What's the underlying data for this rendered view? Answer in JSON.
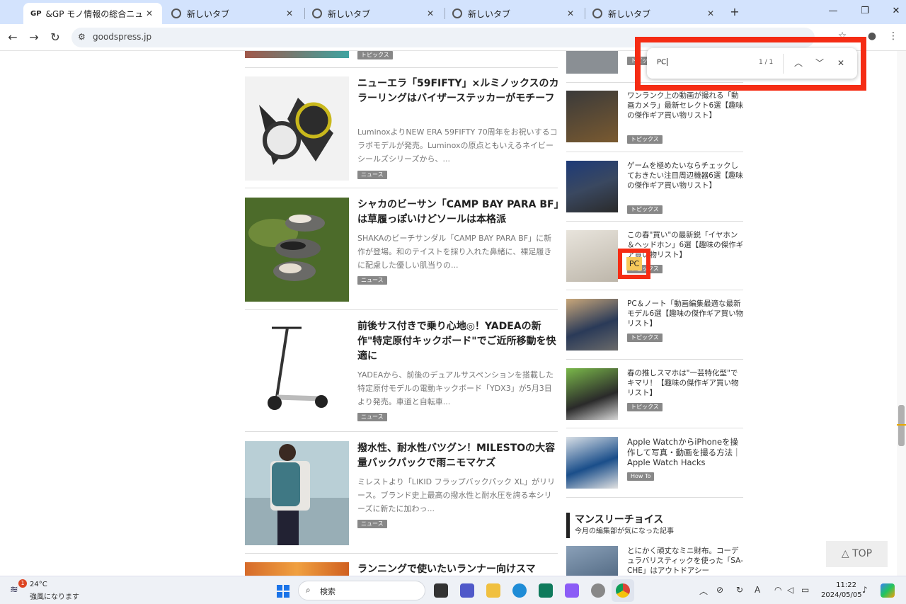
{
  "browser": {
    "tabs": [
      {
        "label": "&GP モノ情報の総合ニュースサイト",
        "favicon": "GP"
      },
      {
        "label": "新しいタブ"
      },
      {
        "label": "新しいタブ"
      },
      {
        "label": "新しいタブ"
      },
      {
        "label": "新しいタブ"
      }
    ],
    "url": "goodspress.jp"
  },
  "find_bar": {
    "query": "PC",
    "count": "1 / 1",
    "highlight_color": "#f52c14"
  },
  "articles": [
    {
      "title": "ニューエラ「59FIFTY」×ルミノックスのカラーリングはバイザーステッカーがモチーフ",
      "excerpt": "LuminoxよりNEW ERA 59FIFTY 70周年をお祝いするコラボモデルが発売。Luminoxの原点ともいえるネイビーシールズシリーズから、...",
      "tag": "ニュース"
    },
    {
      "title": "シャカのビーサン「CAMP BAY PARA BF」は草履っぽいけどソールは本格派",
      "excerpt": "SHAKAのビーチサンダル「CAMP BAY PARA BF」に新作が登場。和のテイストを採り入れた鼻緒に、裸足履きに配慮した優しい肌当りの...",
      "tag": "ニュース"
    },
    {
      "title": "前後サス付きで乗り心地◎！YADEAの新作\"特定原付キックボード\"でご近所移動を快適に",
      "excerpt": "YADEAから、前後のデュアルサスペンションを搭載した特定原付モデルの電動キックボード「YDX3」が5月3日より発売。車道と自転車...",
      "tag": "ニュース"
    },
    {
      "title": "撥水性、耐水性バツグン！MILESTOの大容量バックパックで雨ニモマケズ",
      "excerpt": "ミレストより「LIKID フラップバックパック XL」がリリース。ブランド史上最高の撥水性と耐水圧を誇る本シリーズに新たに加わっ...",
      "tag": "ニュース"
    },
    {
      "title": "ランニングで使いたいランナー向けスマ"
    }
  ],
  "top_partial_tag": "トピックス",
  "sidebar": {
    "items": [
      {
        "title": "",
        "tag": "トピックス"
      },
      {
        "title": "ワンランク上の動画が撮れる「動画カメラ」最新セレクト6選【趣味の傑作ギア買い物リスト】",
        "tag": "トピックス"
      },
      {
        "title": "ゲームを極めたいならチェックしておきたい注目周辺機器6選【趣味の傑作ギア買い物リスト】",
        "tag": "トピックス"
      },
      {
        "title": "この春\"買い\"の最新鋭「イヤホン＆ヘッドホン」6選【趣味の傑作ギア買い物リスト】",
        "tag": "トピックス"
      },
      {
        "title": "PC＆ノート「動画編集最適な最新モデル6選【趣味の傑作ギア買い物リスト】",
        "tag": "トピックス"
      },
      {
        "title": "春の推しスマホは\"一芸特化型\"でキマリ！【趣味の傑作ギア買い物リスト】",
        "tag": "トピックス"
      },
      {
        "title": "Apple WatchからiPhoneを操作して写真・動画を撮る方法｜Apple Watch Hacks",
        "tag": "How To"
      }
    ],
    "highlight_word": "PC",
    "section": {
      "title": "マンスリーチョイス",
      "subtitle": "今月の編集部が気になった記事"
    },
    "monthly_item": "とにかく頑丈なミニ財布。コーデュラバリスティックを使った「SA-CHE」はアウトドアシー"
  },
  "top_button": "△ TOP",
  "taskbar": {
    "weather_badge": "1",
    "temperature": "24°C",
    "weather": "強風になります",
    "search_label": "検索",
    "time": "11:22",
    "date": "2024/05/05"
  }
}
